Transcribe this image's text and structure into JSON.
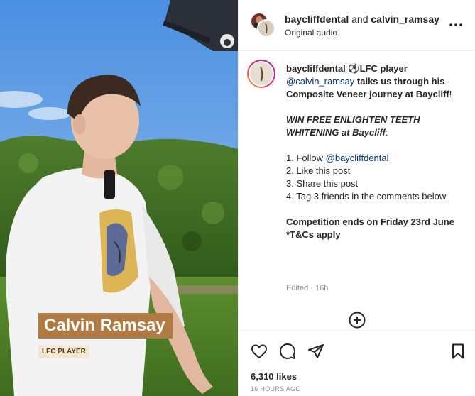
{
  "media": {
    "name_overlay": "Calvin Ramsay",
    "role_overlay": "LFC PLAYER"
  },
  "header": {
    "account_primary": "baycliffdental",
    "joiner": " and ",
    "account_secondary": "calvin_ramsay",
    "subtitle": "Original audio"
  },
  "caption": {
    "username": "baycliffdental",
    "intro": " ⚽LFC player ",
    "mention": "@calvin_ramsay",
    "intro_rest": " talks us through his Composite Veneer journey at Baycliff",
    "intro_end": "!",
    "win_line": "WIN FREE ENLIGHTEN TEETH WHITENING at Baycliff",
    "win_colon": ":",
    "step1_prefix": "1. Follow ",
    "step1_mention": "@baycliffdental",
    "step2": "2. Like this post",
    "step3": "3. Share this post",
    "step4": "4. Tag 3 friends in the comments below",
    "deadline": "Competition ends on Friday 23rd June",
    "terms": "*T&Cs apply",
    "edited": "Edited · 16h"
  },
  "footer": {
    "likes": "6,310 likes",
    "time_ago": "16 HOURS AGO"
  },
  "icons": [
    "more-icon",
    "heart-icon",
    "comment-icon",
    "share-icon",
    "bookmark-icon",
    "add-comment-icon"
  ],
  "colors": {
    "link": "#00376b",
    "muted": "#8e8e8e",
    "overlay_plate": "#b07a44"
  }
}
